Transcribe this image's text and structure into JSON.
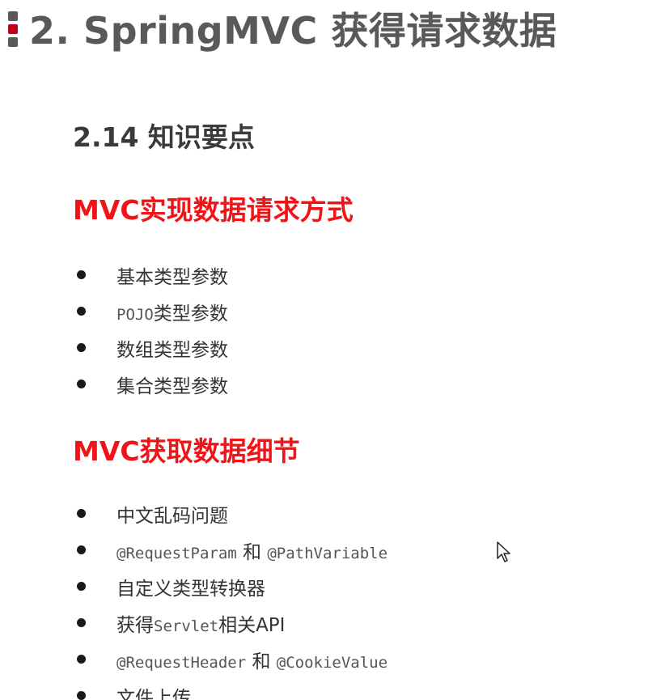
{
  "slide": {
    "title": "2. SpringMVC 获得请求数据"
  },
  "section": {
    "heading": "2.14 知识要点"
  },
  "part1": {
    "heading": "MVC实现数据请求方式",
    "items": [
      {
        "text": "基本类型参数"
      },
      {
        "code": "POJO",
        "text": "类型参数"
      },
      {
        "text": "数组类型参数"
      },
      {
        "text": "集合类型参数"
      }
    ]
  },
  "part2": {
    "heading": "MVC获取数据细节",
    "items": [
      {
        "text": "中文乱码问题"
      },
      {
        "code_a": "@RequestParam",
        "joiner": " 和 ",
        "code_b": "@PathVariable"
      },
      {
        "text": "自定义类型转换器"
      },
      {
        "prefix": "获得",
        "code": "Servlet",
        "suffix": "相关API"
      },
      {
        "code_a": "@RequestHeader",
        "joiner": " 和 ",
        "code_b": "@CookieValue"
      },
      {
        "text": "文件上传"
      }
    ]
  },
  "icons": {
    "title_marker": "slide-title-marker-icon",
    "bullet": "bullet-dot-icon",
    "cursor": "mouse-cursor-icon"
  },
  "colors": {
    "title": "#595959",
    "accent_red": "#f01418",
    "marker_red": "#c0001a"
  }
}
